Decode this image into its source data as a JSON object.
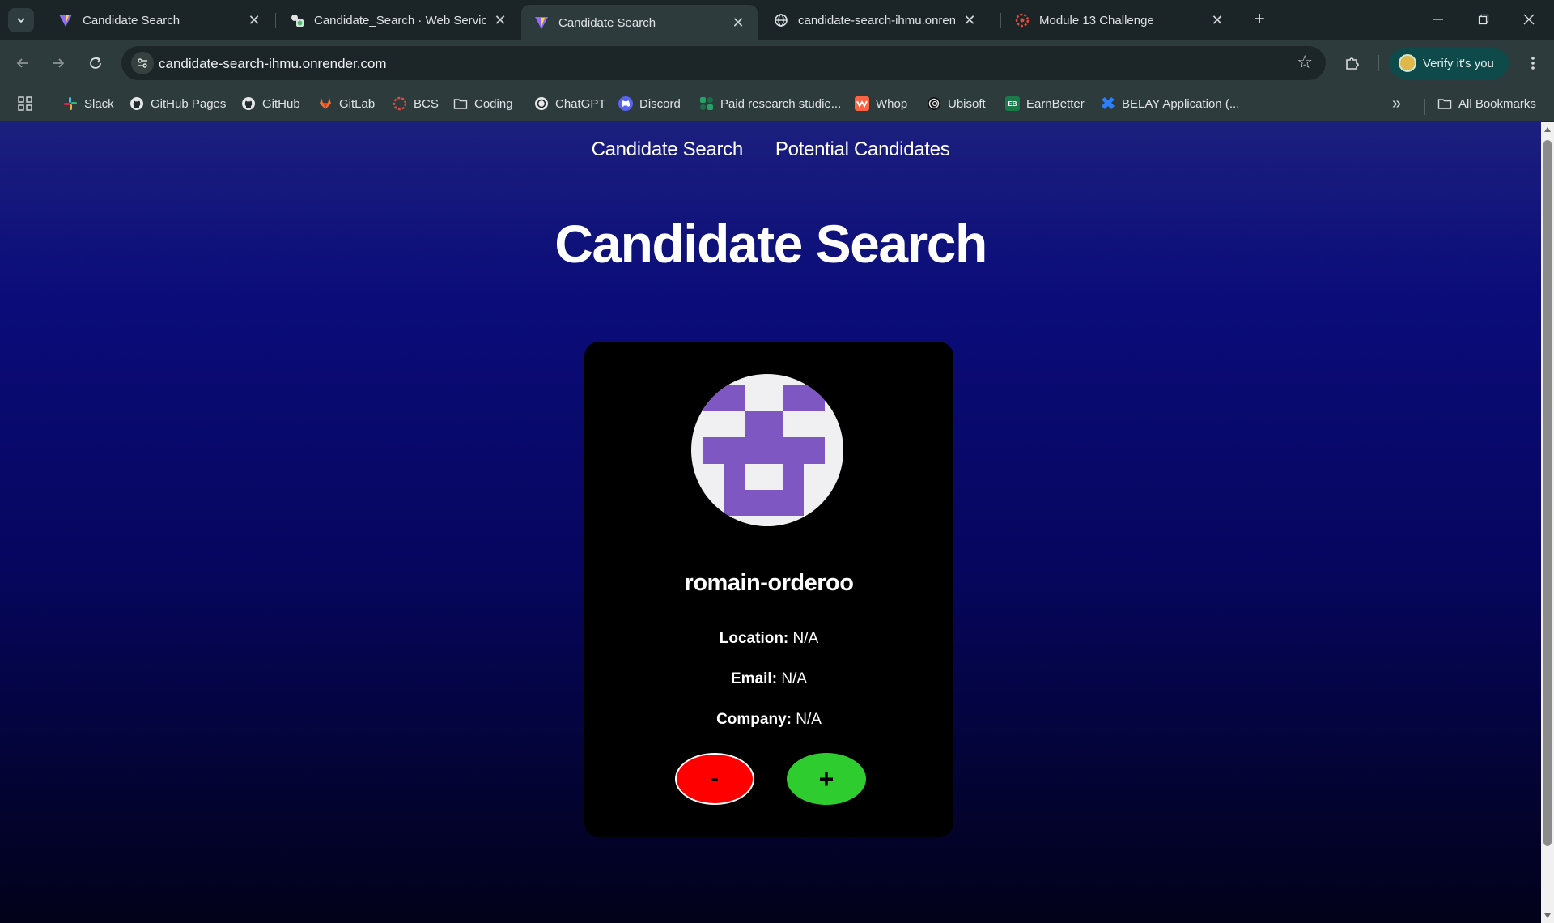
{
  "browser": {
    "tabs": [
      {
        "title": "Candidate Search",
        "icon": "vite-icon",
        "active": false
      },
      {
        "title": "Candidate_Search · Web Servic",
        "icon": "render-icon",
        "active": false
      },
      {
        "title": "Candidate Search",
        "icon": "vite-icon",
        "active": true
      },
      {
        "title": "candidate-search-ihmu.onrend",
        "icon": "globe-icon",
        "active": false
      },
      {
        "title": "Module 13 Challenge",
        "icon": "bcs-icon",
        "active": false
      }
    ],
    "tab_close_glyph": "✕",
    "new_tab_glyph": "+",
    "url": "candidate-search-ihmu.onrender.com",
    "verify_label": "Verify it's you",
    "bookmarks": [
      {
        "label": "Slack",
        "icon": "slack-icon"
      },
      {
        "label": "GitHub Pages",
        "icon": "github-icon"
      },
      {
        "label": "GitHub",
        "icon": "github-icon"
      },
      {
        "label": "GitLab",
        "icon": "gitlab-icon"
      },
      {
        "label": "BCS",
        "icon": "bcs-icon"
      },
      {
        "label": "Coding",
        "icon": "folder-icon"
      },
      {
        "label": "ChatGPT",
        "icon": "chatgpt-icon"
      },
      {
        "label": "Discord",
        "icon": "discord-icon"
      },
      {
        "label": "Paid research studie...",
        "icon": "research-icon"
      },
      {
        "label": "Whop",
        "icon": "whop-icon"
      },
      {
        "label": "Ubisoft",
        "icon": "ubisoft-icon"
      },
      {
        "label": "EarnBetter",
        "icon": "earnbetter-icon"
      },
      {
        "label": "BELAY Application (...",
        "icon": "belay-icon"
      }
    ],
    "more_bookmarks_glyph": "»",
    "all_bookmarks_label": "All Bookmarks"
  },
  "page": {
    "nav": {
      "search": "Candidate Search",
      "potential": "Potential Candidates"
    },
    "title": "Candidate Search",
    "candidate": {
      "username": "romain-orderoo",
      "location_label": "Location:",
      "location": "N/A",
      "email_label": "Email:",
      "email": "N/A",
      "company_label": "Company:",
      "company": "N/A"
    },
    "reject_label": "-",
    "accept_label": "+"
  },
  "colors": {
    "avatar_identicon": "#7e57c2",
    "reject": "#ff0000",
    "accept": "#2ecc2e",
    "bg_top": "#0b0c7a",
    "bg_bottom": "#02021a"
  }
}
